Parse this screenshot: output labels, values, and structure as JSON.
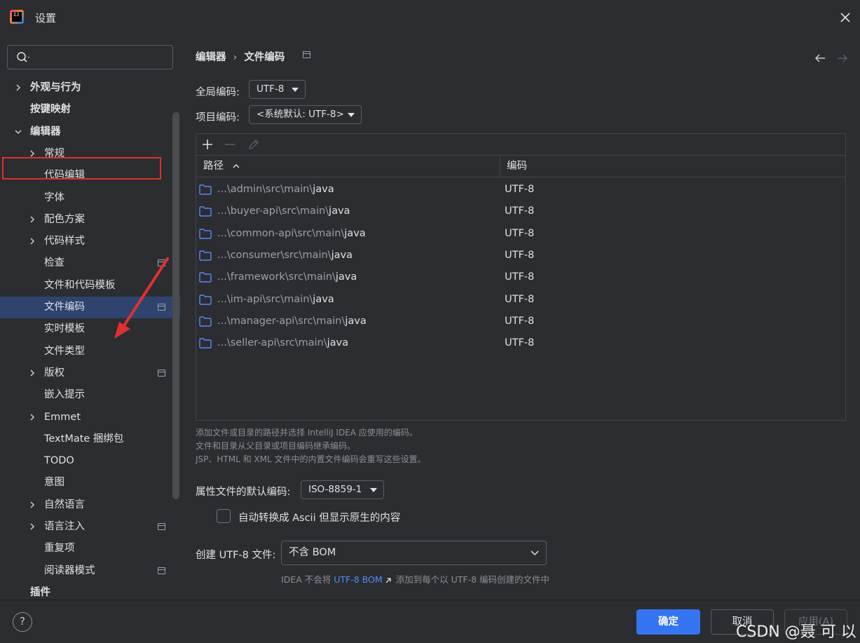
{
  "window": {
    "title": "设置",
    "logo_text": "IJ"
  },
  "sidebar": {
    "search": {
      "placeholder": ""
    },
    "items": [
      {
        "label": "外观与行为",
        "bold": true,
        "chevron": "right"
      },
      {
        "label": "按键映射",
        "bold": true
      },
      {
        "label": "编辑器",
        "bold": true,
        "chevron": "down",
        "highlighted": true
      },
      {
        "label": "常规",
        "chevron": "right"
      },
      {
        "label": "代码编辑"
      },
      {
        "label": "字体"
      },
      {
        "label": "配色方案",
        "chevron": "right"
      },
      {
        "label": "代码样式",
        "chevron": "right"
      },
      {
        "label": "检查",
        "page_icon": true
      },
      {
        "label": "文件和代码模板"
      },
      {
        "label": "文件编码",
        "selected": true,
        "page_icon": true
      },
      {
        "label": "实时模板"
      },
      {
        "label": "文件类型"
      },
      {
        "label": "版权",
        "chevron": "right",
        "page_icon": true
      },
      {
        "label": "嵌入提示"
      },
      {
        "label": "Emmet",
        "chevron": "right"
      },
      {
        "label": "TextMate 捆绑包"
      },
      {
        "label": "TODO"
      },
      {
        "label": "意图"
      },
      {
        "label": "自然语言",
        "chevron": "right"
      },
      {
        "label": "语言注入",
        "chevron": "right",
        "page_icon": true
      },
      {
        "label": "重复项"
      },
      {
        "label": "阅读器模式",
        "page_icon": true
      },
      {
        "label": "插件",
        "bold": true
      }
    ]
  },
  "breadcrumb": {
    "parent": "编辑器",
    "separator": "›",
    "current": "文件编码"
  },
  "form": {
    "global_encoding_label": "全局编码:",
    "global_encoding_value": "UTF-8",
    "project_encoding_label": "项目编码:",
    "project_encoding_value": "<系统默认: UTF-8>",
    "properties_label": "属性文件的默认编码:",
    "properties_value": "ISO-8859-1",
    "ascii_checkbox_label": "自动转换成 Ascii 但显示原生的内容",
    "ascii_checkbox_checked": false,
    "bom_label": "创建 UTF-8 文件:",
    "bom_value": "不含 BOM",
    "bom_hint_prefix": "IDEA 不会将",
    "bom_hint_link": "UTF-8 BOM",
    "bom_hint_suffix": "添加到每个以 UTF-8 编码创建的文件中"
  },
  "table": {
    "columns": [
      "路径",
      "编码"
    ],
    "rows": [
      {
        "prefix": "...\\admin\\src\\main\\",
        "name": "java",
        "encoding": "UTF-8"
      },
      {
        "prefix": "...\\buyer-api\\src\\main\\",
        "name": "java",
        "encoding": "UTF-8"
      },
      {
        "prefix": "...\\common-api\\src\\main\\",
        "name": "java",
        "encoding": "UTF-8"
      },
      {
        "prefix": "...\\consumer\\src\\main\\",
        "name": "java",
        "encoding": "UTF-8"
      },
      {
        "prefix": "...\\framework\\src\\main\\",
        "name": "java",
        "encoding": "UTF-8"
      },
      {
        "prefix": "...\\im-api\\src\\main\\",
        "name": "java",
        "encoding": "UTF-8"
      },
      {
        "prefix": "...\\manager-api\\src\\main\\",
        "name": "java",
        "encoding": "UTF-8"
      },
      {
        "prefix": "...\\seller-api\\src\\main\\",
        "name": "java",
        "encoding": "UTF-8"
      }
    ]
  },
  "hint_lines": [
    "添加文件或目录的路径并选择 IntelliJ IDEA 应使用的编码。",
    "文件和目录从父目录或项目编码继承编码。",
    "JSP、HTML 和 XML 文件中的内置文件编码会重写这些设置。"
  ],
  "footer": {
    "help": "?",
    "ok": "确定",
    "cancel": "取消",
    "apply": "应用(A)",
    "watermark": "CSDN @聂 可 以"
  },
  "colors": {
    "background": "#2b2d30",
    "selection": "#2e436e",
    "accent": "#3574f0",
    "link": "#548af7",
    "annotation_red": "#e0302f",
    "folder": "#548af7"
  }
}
